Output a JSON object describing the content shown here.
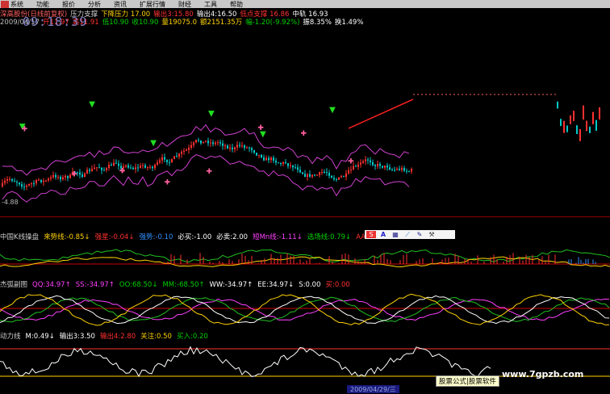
{
  "menu": {
    "items": [
      "系统",
      "功能",
      "报价",
      "分析",
      "资讯",
      "扩展行情",
      "财经",
      "工具",
      "帮助"
    ]
  },
  "info1": [
    {
      "t": "深高股份(日线前复权)",
      "c": "#ff6060"
    },
    {
      "t": "压力支撑",
      "c": "#ccc"
    },
    {
      "t": "下降压力 17.00",
      "c": "#ffd200"
    },
    {
      "t": "输出3:15.80",
      "c": "#ff3030"
    },
    {
      "t": "输出4:16.50",
      "c": "#ffffff"
    },
    {
      "t": "低点支撑 16.86",
      "c": "#ff3030"
    },
    {
      "t": "中轨 16.93",
      "c": "#ffffff"
    }
  ],
  "info2": [
    {
      "t": "2009/04/17",
      "c": "#bbb"
    },
    {
      "t": "开11.97",
      "c": "#ff3030"
    },
    {
      "t": "高11.91",
      "c": "#ff3030"
    },
    {
      "t": "低10.90",
      "c": "#00d000"
    },
    {
      "t": "收10.90",
      "c": "#00d000"
    },
    {
      "t": "量19075.0",
      "c": "#ffd200"
    },
    {
      "t": "额2151.35万",
      "c": "#ffd200"
    },
    {
      "t": "幅-1.20(-9.92%)",
      "c": "#00d000"
    },
    {
      "t": "振8.35%",
      "c": "#ffffff"
    },
    {
      "t": "换1.49%",
      "c": "#ffffff"
    }
  ],
  "clock": "09:18:39",
  "lowprice": "-4.88",
  "ind1": [
    {
      "t": "中国K线操盘",
      "c": "#ccc"
    },
    {
      "t": "来势线:-0.85↓",
      "c": "#ffd200"
    },
    {
      "t": "强星:-0.04↓",
      "c": "#ff3030"
    },
    {
      "t": "强势:-0.10",
      "c": "#3090ff"
    },
    {
      "t": "必买:-1.00",
      "c": "#ffffff"
    },
    {
      "t": "必卖:2.00",
      "c": "#ffffff"
    },
    {
      "t": "短Mn线:-1.11↓",
      "c": "#ff40ff"
    },
    {
      "t": "选场线:0.79↓",
      "c": "#00d000"
    },
    {
      "t": "AA:0.00",
      "c": "#ff3030"
    }
  ],
  "ind2": [
    {
      "t": "杰弧副图",
      "c": "#ccc"
    },
    {
      "t": "QQ:34.97↑",
      "c": "#ff40ff"
    },
    {
      "t": "SS:-34.97↑",
      "c": "#ff40ff"
    },
    {
      "t": "OO:68.50↓",
      "c": "#00d000"
    },
    {
      "t": "MM:-68.50↑",
      "c": "#00d000"
    },
    {
      "t": "WW:-34.97↑",
      "c": "#ffffff"
    },
    {
      "t": "EE:34.97↓",
      "c": "#ffffff"
    },
    {
      "t": "S:0.00",
      "c": "#ffffff"
    },
    {
      "t": "买:0.00",
      "c": "#ff3030"
    }
  ],
  "ind3": [
    {
      "t": "动力线",
      "c": "#ccc"
    },
    {
      "t": "M:0.49↓",
      "c": "#ffffff"
    },
    {
      "t": "输出3:3.50",
      "c": "#ffffff"
    },
    {
      "t": "输出4:2.80",
      "c": "#ff3030"
    },
    {
      "t": "关注:0.50",
      "c": "#ffd200"
    },
    {
      "t": "买入:0.20",
      "c": "#00d000"
    }
  ],
  "bottom_date": "2009/04/29/三",
  "ad_text": "股票公式|股票软件",
  "watermark": "www.7gpzb.com"
}
